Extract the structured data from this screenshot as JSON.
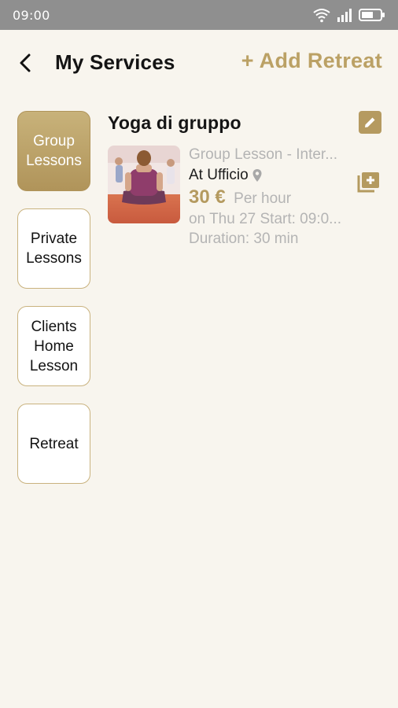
{
  "status_bar": {
    "time": "09:00"
  },
  "header": {
    "title": "My Services",
    "add_retreat": "+ Add Retreat"
  },
  "categories": [
    {
      "label": "Group Lessons",
      "active": true
    },
    {
      "label": "Private Lessons",
      "active": false
    },
    {
      "label": "Clients Home Lesson",
      "active": false
    },
    {
      "label": "Retreat",
      "active": false
    }
  ],
  "service": {
    "title": "Yoga di gruppo",
    "type": "Group Lesson - Inter...",
    "location": "At Ufficio",
    "price": "30 €",
    "price_unit": "Per hour",
    "schedule": "on Thu 27 Start: 09:0...",
    "duration": "Duration: 30 min"
  },
  "colors": {
    "accent": "#b49a5f",
    "background": "#f8f5ee",
    "muted_text": "#b4b4b4",
    "status_bar": "#8f8f8f"
  },
  "icons": [
    "back-arrow-icon",
    "edit-pencil-icon",
    "location-pin-icon",
    "add-to-queue-icon",
    "wifi-icon",
    "signal-icon",
    "battery-icon"
  ]
}
